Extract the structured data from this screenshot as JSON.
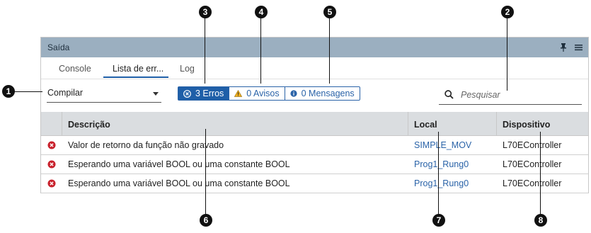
{
  "panel": {
    "title": "Saída"
  },
  "tabs": [
    {
      "label": "Console"
    },
    {
      "label": "Lista de err..."
    },
    {
      "label": "Log"
    }
  ],
  "filter": {
    "dropdown_value": "Compilar"
  },
  "chips": {
    "errors": "3 Erros",
    "warnings": "0 Avisos",
    "messages": "0 Mensagens"
  },
  "search": {
    "placeholder": "Pesquisar"
  },
  "table": {
    "columns": [
      "Descrição",
      "Local",
      "Dispositivo"
    ],
    "rows": [
      {
        "description": "Valor de retorno da função não gravado",
        "location": "SIMPLE_MOV",
        "device": "L70EController"
      },
      {
        "description": "Esperando uma variável BOOL ou uma constante BOOL",
        "location": "Prog1_Rung0",
        "device": "L70EController"
      },
      {
        "description": "Esperando uma variável BOOL ou uma constante BOOL",
        "location": "Prog1_Rung0",
        "device": "L70EController"
      }
    ]
  },
  "callouts": [
    "1",
    "2",
    "3",
    "4",
    "5",
    "6",
    "7",
    "8"
  ],
  "colors": {
    "accent": "#1f5fa8",
    "error": "#c8202b",
    "warning": "#f2b01e",
    "titlebar": "#9bafc0"
  }
}
